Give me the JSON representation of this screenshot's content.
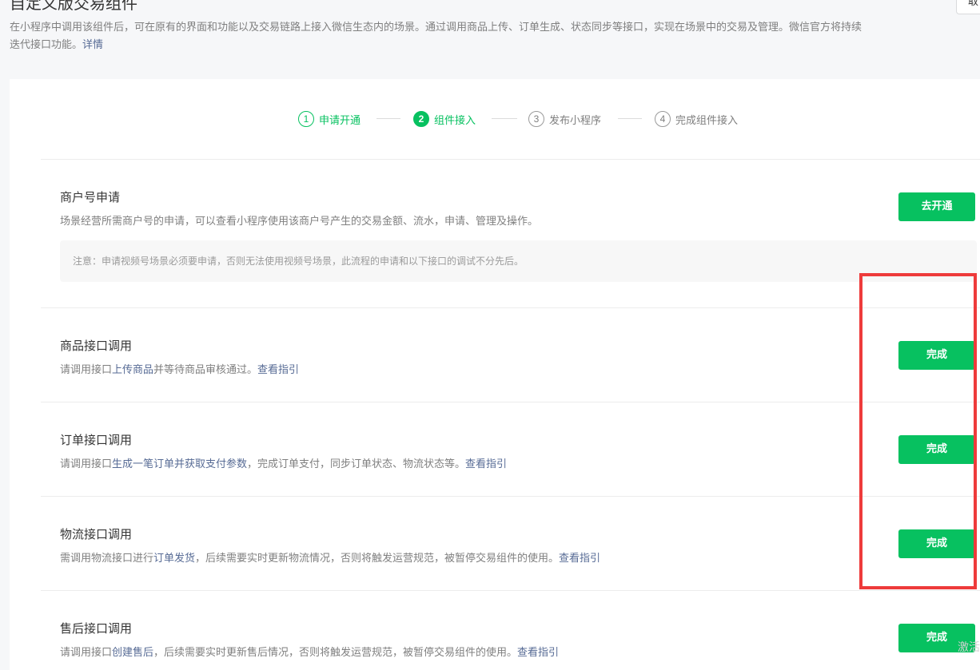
{
  "header": {
    "title": "自定义版交易组件",
    "top_right_button": "取"
  },
  "intro": {
    "text": "在小程序中调用该组件后，可在原有的界面和功能以及交易链路上接入微信生态内的场景。通过调用商品上传、订单生成、状态同步等接口，实现在场景中的交易及管理。微信官方将持续迭代接口功能。",
    "link": "详情"
  },
  "steps": [
    {
      "num": "1",
      "label": "申请开通",
      "state": "done"
    },
    {
      "num": "2",
      "label": "组件接入",
      "state": "active"
    },
    {
      "num": "3",
      "label": "发布小程序",
      "state": "pending"
    },
    {
      "num": "4",
      "label": "完成组件接入",
      "state": "pending"
    }
  ],
  "sections": {
    "merchant": {
      "title": "商户号申请",
      "desc": "场景经营所需商户号的申请，可以查看小程序使用该商户号产生的交易金额、流水，申请、管理及操作。",
      "notice": "注意：申请视频号场景必须要申请，否则无法使用视频号场景，此流程的申请和以下接口的调试不分先后。",
      "button": "去开通"
    },
    "product": {
      "title": "商品接口调用",
      "desc_pre": "请调用接口",
      "desc_link": "上传商品",
      "desc_post": "并等待商品审核通过。",
      "guide": "查看指引",
      "button": "完成"
    },
    "order": {
      "title": "订单接口调用",
      "desc_pre": "请调用接口",
      "desc_link": "生成一笔订单并获取支付参数",
      "desc_post": "，完成订单支付，同步订单状态、物流状态等。",
      "guide": "查看指引",
      "button": "完成"
    },
    "logistics": {
      "title": "物流接口调用",
      "desc_pre": "需调用物流接口进行",
      "desc_link": "订单发货",
      "desc_post": "，后续需要实时更新物流情况，否则将触发运营规范，被暂停交易组件的使用。",
      "guide": "查看指引",
      "button": "完成"
    },
    "aftersale": {
      "title": "售后接口调用",
      "desc_pre": "请调用接口",
      "desc_link": "创建售后",
      "desc_post": "，后续需要实时更新售后情况，否则将触发运营规范，被暂停交易组件的使用。",
      "guide": "查看指引",
      "button": "完成"
    }
  },
  "watermark": "激活",
  "colors": {
    "accent": "#07c160",
    "link": "#576b95",
    "highlight": "#ee3b3b"
  }
}
